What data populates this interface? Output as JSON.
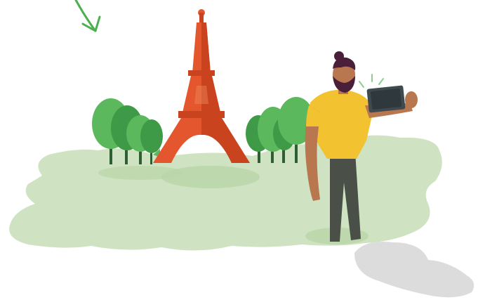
{
  "illustration": {
    "subject": "person-taking-selfie-with-eiffel-tower-icon",
    "colors": {
      "arrow": "#4caf50",
      "ground": "#cfe3c2",
      "ground_shadow": "#b9d4a7",
      "puddle": "#dcdcdc",
      "tower": "#e4572e",
      "tower_dark": "#c9431f",
      "tree_light": "#5cb85c",
      "tree_dark": "#3f9a47",
      "trunk": "#2e5f33",
      "shirt": "#f2c230",
      "pants": "#4a4f47",
      "skin": "#b8774f",
      "hair": "#4a1f3a",
      "phone": "#3f4a4f"
    }
  }
}
